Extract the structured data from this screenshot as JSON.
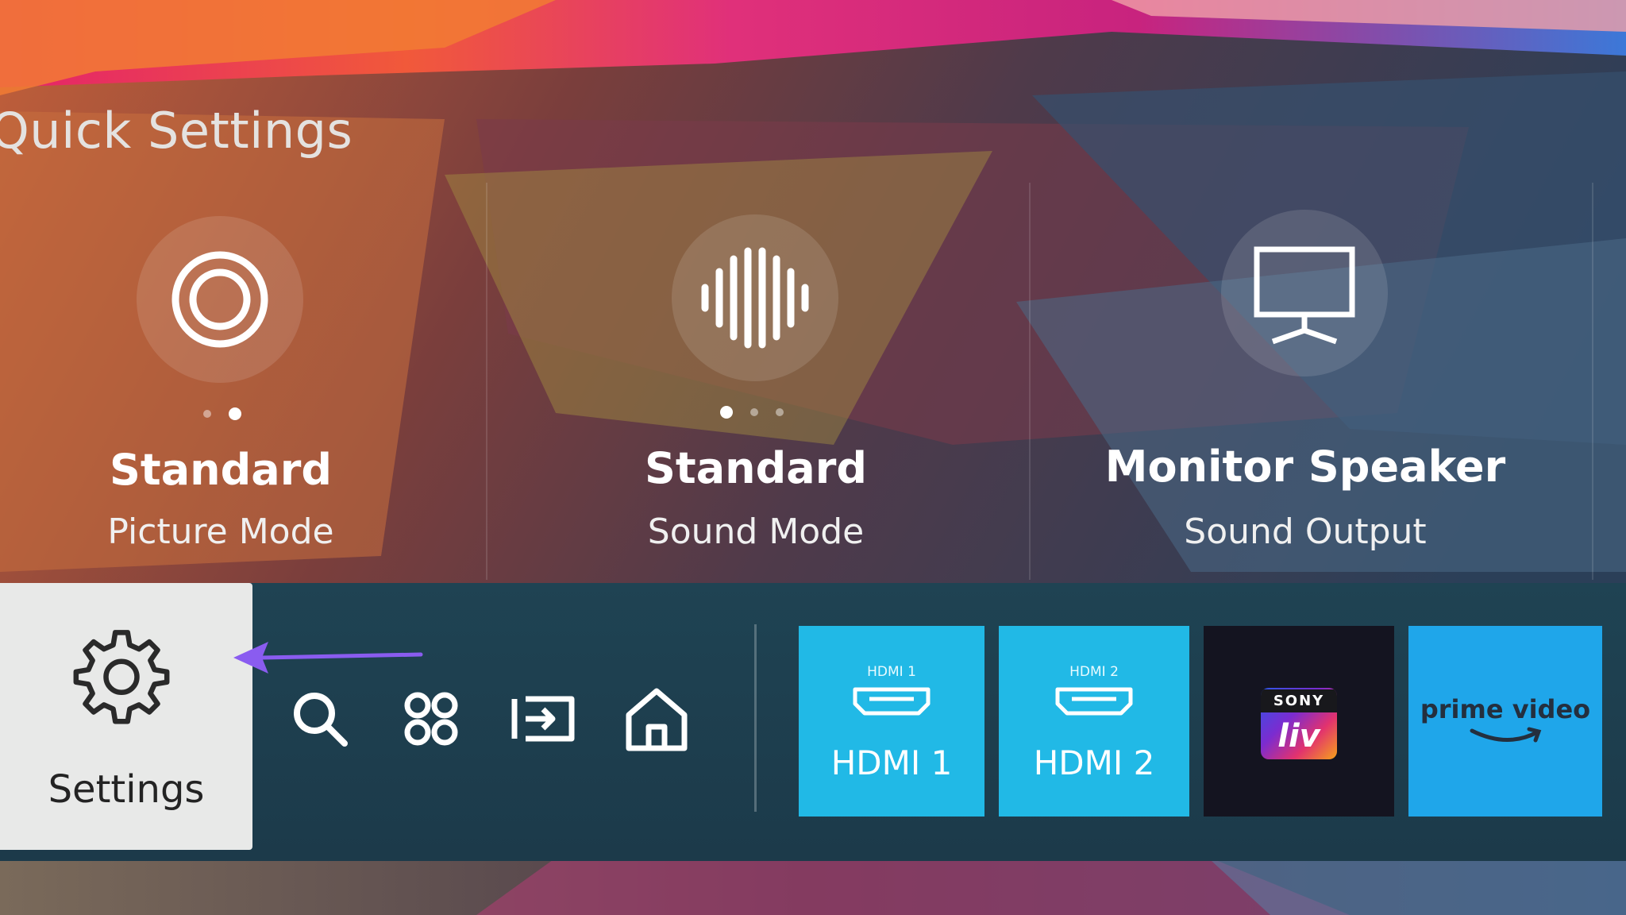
{
  "screen_title": "Quick Settings",
  "quick_settings": [
    {
      "value": "Standard",
      "label": "Picture Mode",
      "icon": "picture-mode-icon",
      "page_count": 2,
      "active_page": 2
    },
    {
      "value": "Standard",
      "label": "Sound Mode",
      "icon": "sound-mode-icon",
      "page_count": 3,
      "active_page": 1
    },
    {
      "value": "Monitor Speaker",
      "label": "Sound Output",
      "icon": "monitor-icon"
    }
  ],
  "settings_tile": {
    "label": "Settings",
    "icon": "gear-icon"
  },
  "nav_icons": [
    "search-icon",
    "apps-icon",
    "source-input-icon",
    "home-icon"
  ],
  "apps": [
    {
      "small": "HDMI 1",
      "label": "HDMI 1",
      "type": "hdmi"
    },
    {
      "small": "HDMI 2",
      "label": "HDMI 2",
      "type": "hdmi"
    },
    {
      "brand": "SONY",
      "name": "liv",
      "type": "sonyliv"
    },
    {
      "name": "prime video",
      "type": "prime"
    }
  ],
  "colors": {
    "hdmi_tile": "#21b9e6",
    "prime_tile": "#1fa6ea",
    "annotation_arrow": "#8a5cf0",
    "settings_tile": "#e8e9e8"
  }
}
